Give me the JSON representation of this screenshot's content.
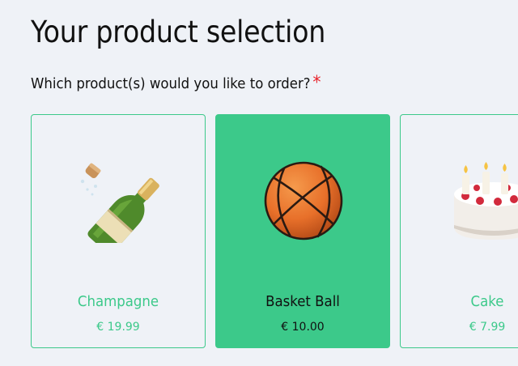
{
  "page": {
    "title": "Your product selection",
    "question": "Which product(s) would you like to order?",
    "required_marker": "*"
  },
  "colors": {
    "accent": "#3cc98a",
    "background": "#eff2f7",
    "required": "#e8232b"
  },
  "products": [
    {
      "name": "Champagne",
      "price": "€ 19.99",
      "icon": "champagne-icon",
      "selected": false
    },
    {
      "name": "Basket Ball",
      "price": "€ 10.00",
      "icon": "basketball-icon",
      "selected": true
    },
    {
      "name": "Cake",
      "price": "€ 7.99",
      "icon": "cake-icon",
      "selected": false
    }
  ]
}
